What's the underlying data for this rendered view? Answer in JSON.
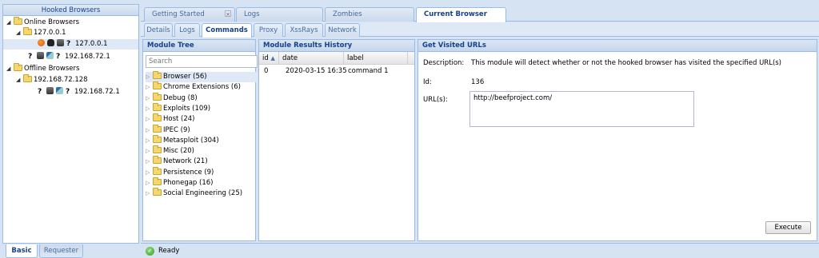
{
  "left": {
    "title": "Hooked Browsers",
    "online_label": "Online Browsers",
    "online_group": "127.0.0.1",
    "online_entries": [
      {
        "ip": "127.0.0.1"
      },
      {
        "ip": "192.168.72.1"
      }
    ],
    "offline_label": "Offline Browsers",
    "offline_group": "192.168.72.128",
    "offline_entries": [
      {
        "ip": "192.168.72.1"
      }
    ],
    "unknown_glyph": "?",
    "bottom_tabs": [
      "Basic",
      "Requester"
    ]
  },
  "top_tabs": [
    "Getting Started",
    "Logs",
    "Zombies",
    "Current Browser"
  ],
  "sub_tabs": [
    "Details",
    "Logs",
    "Commands",
    "Proxy",
    "XssRays",
    "Network"
  ],
  "module_tree": {
    "title": "Module Tree",
    "search_placeholder": "Search",
    "items": [
      "Browser (56)",
      "Chrome Extensions (6)",
      "Debug (8)",
      "Exploits (109)",
      "Host (24)",
      "IPEC (9)",
      "Metasploit (304)",
      "Misc (20)",
      "Network (21)",
      "Persistence (9)",
      "Phonegap (16)",
      "Social Engineering (25)"
    ]
  },
  "results": {
    "title": "Module Results History",
    "columns": [
      "id",
      "date",
      "label"
    ],
    "sort_glyph": "▲",
    "rows": [
      {
        "id": "0",
        "date": "2020-03-15 16:35",
        "label": "command 1"
      }
    ]
  },
  "detail": {
    "title": "Get Visited URLs",
    "description_label": "Description:",
    "description": "This module will detect whether or not the hooked browser has visited the specified URL(s)",
    "id_label": "Id:",
    "id_value": "136",
    "urls_label": "URL(s):",
    "urls_value": "http://beefproject.com/",
    "execute_label": "Execute"
  },
  "status": {
    "text": "Ready"
  },
  "colors": {
    "panel_border": "#99bbe8",
    "header_text": "#15428b",
    "selected_row": "#dfe8f6",
    "background": "#d6e3f2"
  }
}
